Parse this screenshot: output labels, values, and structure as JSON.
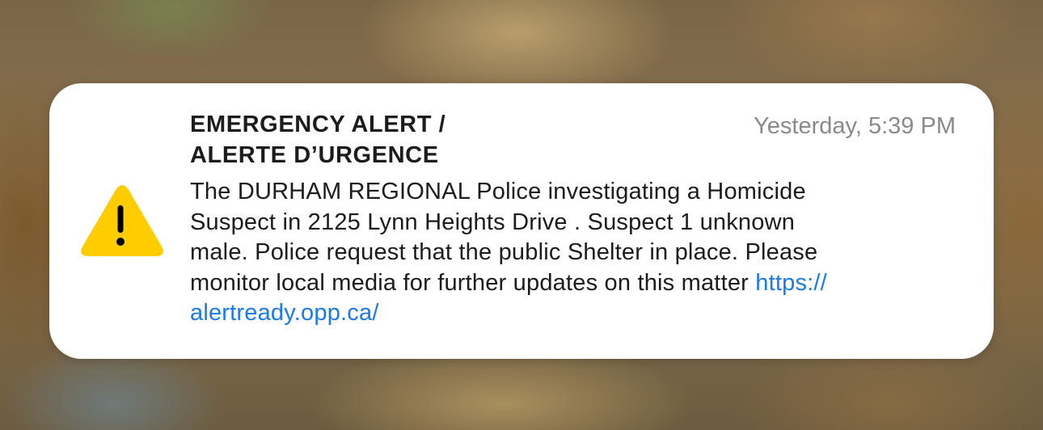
{
  "notification": {
    "title_line1": "EMERGENCY ALERT /",
    "title_line2": "ALERTE D’URGENCE",
    "timestamp": "Yesterday, 5:39 PM",
    "message_lines": [
      "The DURHAM REGIONAL Police investigating a Homicide",
      "Suspect in 2125 Lynn Heights Drive . Suspect 1 unknown",
      "male. Police request that the public Shelter in place. Please",
      "monitor local media for further updates on this matter "
    ],
    "link_part1": "https://",
    "link_part2": "alertready.opp.ca/",
    "icon": "warning-triangle-icon"
  },
  "colors": {
    "card_background": "#ffffff",
    "title_text": "#1c1c1e",
    "timestamp_text": "#8a8a8e",
    "link": "#1a7ae6",
    "warning_yellow": "#ffcc00",
    "warning_mark": "#000000"
  }
}
